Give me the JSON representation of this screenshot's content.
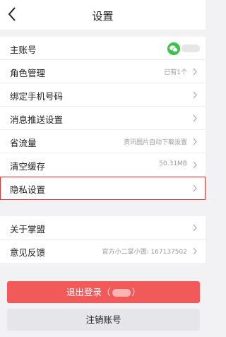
{
  "header": {
    "title": "设置"
  },
  "settings": [
    {
      "label": "主账号",
      "value": ""
    },
    {
      "label": "角色管理",
      "value": "已有1个"
    },
    {
      "label": "绑定手机号码",
      "value": ""
    },
    {
      "label": "消息推送设置",
      "value": ""
    },
    {
      "label": "省流量",
      "value": "资讯图片自动下载设置"
    },
    {
      "label": "清空缓存",
      "value": "50.31MB"
    },
    {
      "label": "隐私设置",
      "value": ""
    }
  ],
  "about": [
    {
      "label": "关于掌盟",
      "value": ""
    },
    {
      "label": "意见反馈",
      "value": "官方小二掌小盟: 167137502"
    }
  ],
  "buttons": {
    "logout_prefix": "退出登录（",
    "logout_suffix": "）",
    "deregister": "注销账号"
  },
  "colors": {
    "logout_bg": "#f25a5a",
    "wechat_green": "#3cc24a",
    "highlight_border": "#e23636"
  }
}
